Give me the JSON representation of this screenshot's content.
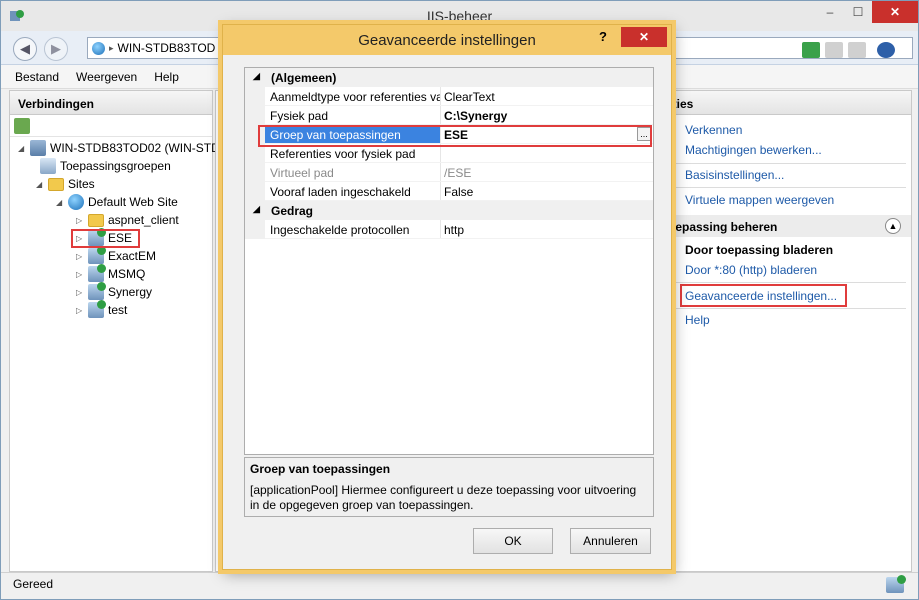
{
  "window": {
    "title": "IIS-beheer",
    "minimize": "–",
    "maximize": "☐",
    "close": "✕"
  },
  "addressbar": {
    "path": "WIN-STDB83TOD",
    "separator": "▸"
  },
  "menu": [
    "Bestand",
    "Weergeven",
    "Help"
  ],
  "connections": {
    "title": "Verbindingen",
    "tree": {
      "server": "WIN-STDB83TOD02 (WIN-STD",
      "app_pools": "Toepassingsgroepen",
      "sites": "Sites",
      "default_site": "Default Web Site",
      "children": [
        "aspnet_client",
        "ESE",
        "ExactEM",
        "MSMQ",
        "Synergy",
        "test"
      ]
    }
  },
  "actions": {
    "title": "cties",
    "links_top": [
      "Verkennen",
      "Machtigingen bewerken...",
      "Basisinstellingen...",
      "Virtuele mappen weergeven"
    ],
    "section_title": "oepassing beheren",
    "browse_title": "Door toepassing bladeren",
    "browse_link": "Door *:80 (http) bladeren",
    "advanced_link": "Geavanceerde instellingen...",
    "help_link": "Help"
  },
  "status": {
    "text": "Gereed"
  },
  "dialog": {
    "title": "Geavanceerde instellingen",
    "help": "?",
    "close": "✕",
    "categories": [
      {
        "name": "(Algemeen)",
        "toggle": "◢"
      },
      {
        "name": "Gedrag",
        "toggle": "◢"
      }
    ],
    "properties": [
      {
        "name": "Aanmeldtype voor referenties va",
        "value": "ClearText"
      },
      {
        "name": "Fysiek pad",
        "value": "C:\\Synergy"
      },
      {
        "name": "Groep van toepassingen",
        "value": "ESE",
        "button": "..."
      },
      {
        "name": "Referenties voor fysiek pad",
        "value": ""
      },
      {
        "name": "Virtueel pad",
        "value": "/ESE"
      },
      {
        "name": "Vooraf laden ingeschakeld",
        "value": "False"
      },
      {
        "name": "Ingeschakelde protocollen",
        "value": "http"
      }
    ],
    "description": {
      "title": "Groep van toepassingen",
      "text": "[applicationPool] Hiermee configureert u deze toepassing voor uitvoering in de opgegeven groep van toepassingen."
    },
    "ok": "OK",
    "cancel": "Annuleren"
  },
  "colors": {
    "highlight": "#e03c3c",
    "dialog_frame": "#f4c96a",
    "selection": "#3b83e0",
    "link": "#1e5aa8"
  }
}
